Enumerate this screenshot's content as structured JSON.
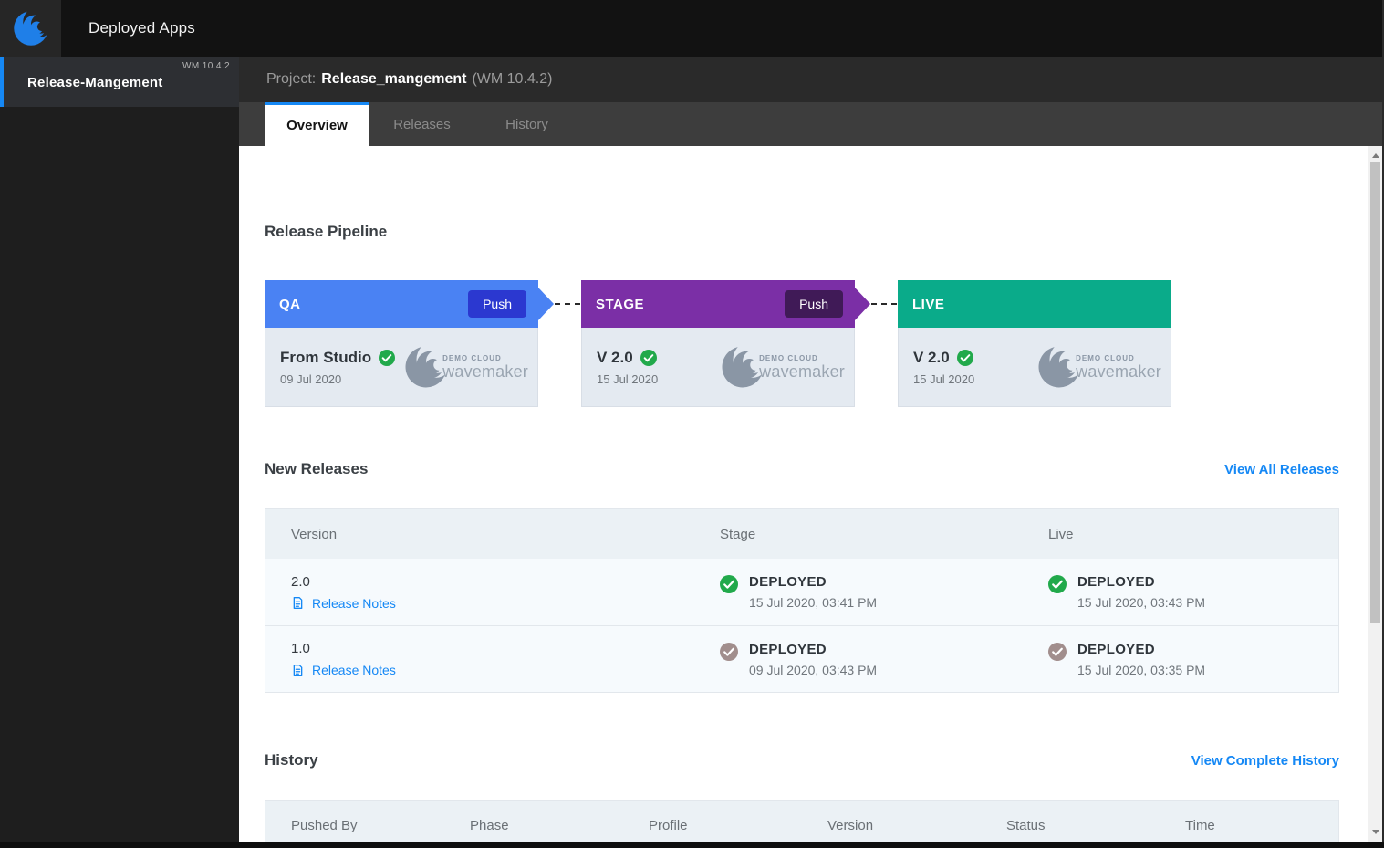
{
  "topbar": {
    "title": "Deployed Apps"
  },
  "sidebar": {
    "items": [
      {
        "name": "Release-Mangement",
        "version": "WM 10.4.2",
        "active": true
      }
    ]
  },
  "project_bar": {
    "label": "Project:",
    "name": "Release_mangement",
    "version": "(WM 10.4.2)"
  },
  "tabs": [
    {
      "label": "Overview",
      "active": true
    },
    {
      "label": "Releases",
      "active": false
    },
    {
      "label": "History",
      "active": false
    }
  ],
  "pipeline": {
    "heading": "Release Pipeline",
    "stages": [
      {
        "name": "QA",
        "push_label": "Push",
        "has_push": true,
        "title": "From Studio",
        "date": "09 Jul 2020",
        "status": "success"
      },
      {
        "name": "STAGE",
        "push_label": "Push",
        "has_push": true,
        "title": "V 2.0",
        "date": "15 Jul 2020",
        "status": "success"
      },
      {
        "name": "LIVE",
        "push_label": "",
        "has_push": false,
        "title": "V 2.0",
        "date": "15 Jul 2020",
        "status": "success"
      }
    ],
    "cloud_logo": {
      "line1": "DEMO CLOUD",
      "line2": "wavemaker"
    }
  },
  "new_releases": {
    "heading": "New Releases",
    "link": "View All Releases",
    "columns": [
      "Version",
      "Stage",
      "Live"
    ],
    "rows": [
      {
        "version": "2.0",
        "notes_label": "Release Notes",
        "stage": {
          "status": "DEPLOYED",
          "time": "15 Jul 2020, 03:41 PM",
          "state": "current"
        },
        "live": {
          "status": "DEPLOYED",
          "time": "15 Jul 2020, 03:43 PM",
          "state": "current"
        }
      },
      {
        "version": "1.0",
        "notes_label": "Release Notes",
        "stage": {
          "status": "DEPLOYED",
          "time": "09 Jul 2020, 03:43 PM",
          "state": "previous"
        },
        "live": {
          "status": "DEPLOYED",
          "time": "15 Jul 2020, 03:35 PM",
          "state": "previous"
        }
      }
    ]
  },
  "history": {
    "heading": "History",
    "link": "View Complete History",
    "columns": [
      "Pushed By",
      "Phase",
      "Profile",
      "Version",
      "Status",
      "Time"
    ]
  },
  "colors": {
    "accent_blue": "#1588f5",
    "qa_header": "#4a82f3",
    "qa_push": "#2b38d0",
    "stage_header": "#7b2fa6",
    "stage_push": "#401a57",
    "live_header": "#0aab8a",
    "success_green": "#21a94b",
    "previous_check": "#a18e8d",
    "cloud_logo_gray": "#8a96a5"
  }
}
